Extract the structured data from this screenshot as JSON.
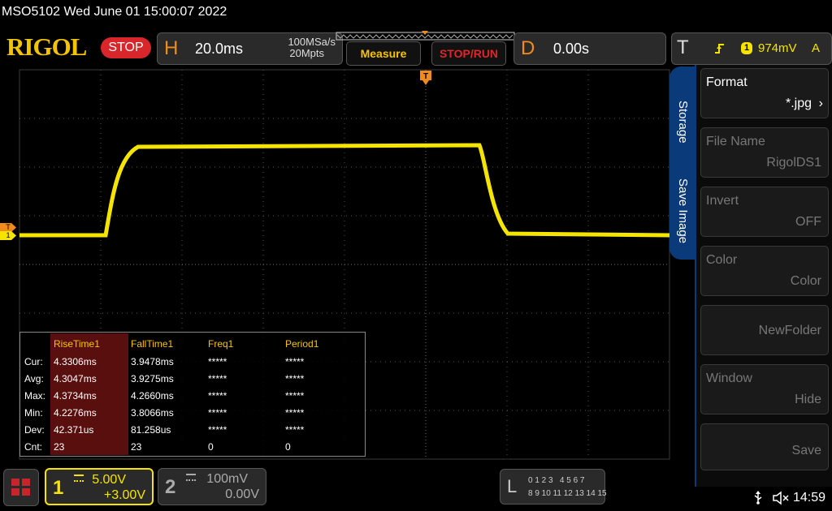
{
  "header": {
    "model_datetime": "MSO5102   Wed June 01 15:00:07 2022",
    "logo": "RIGOL",
    "run_state": "STOP",
    "h_letter": "H",
    "timebase": "20.0ms",
    "sample_rate": "100MSa/s",
    "memory_depth": "20Mpts",
    "measure_label": "Measure",
    "stoprun_label": "STOP/RUN",
    "d_letter": "D",
    "delay": "0.00s",
    "t_letter": "T",
    "trigger_channel": "1",
    "trigger_level": "974mV",
    "trigger_mode": "A"
  },
  "trigger_marker": "T",
  "channel_marker": "1",
  "measurements": {
    "columns": [
      "RiseTime1",
      "FallTime1",
      "Freq1",
      "Period1"
    ],
    "rows": [
      {
        "label": "Cur:",
        "values": [
          "4.3306ms",
          "3.9478ms",
          "*****",
          "*****"
        ]
      },
      {
        "label": "Avg:",
        "values": [
          "4.3047ms",
          "3.9275ms",
          "*****",
          "*****"
        ]
      },
      {
        "label": "Max:",
        "values": [
          "4.3734ms",
          "4.2660ms",
          "*****",
          "*****"
        ]
      },
      {
        "label": "Min:",
        "values": [
          "4.2276ms",
          "3.8066ms",
          "*****",
          "*****"
        ]
      },
      {
        "label": "Dev:",
        "values": [
          "42.371us",
          "81.258us",
          "*****",
          "*****"
        ]
      },
      {
        "label": "Cnt:",
        "values": [
          "23",
          "23",
          "0",
          "0"
        ]
      }
    ]
  },
  "side_tabs": {
    "storage": "Storage",
    "save_image": "Save Image"
  },
  "menu": [
    {
      "label": "Format",
      "value": "*.jpg",
      "enabled": true
    },
    {
      "label": "File Name",
      "value": "RigolDS1",
      "enabled": false
    },
    {
      "label": "Invert",
      "value": "OFF",
      "enabled": false
    },
    {
      "label": "Color",
      "value": "Color",
      "enabled": false
    },
    {
      "label": "",
      "value": "NewFolder",
      "enabled": false
    },
    {
      "label": "Window",
      "value": "Hide",
      "enabled": false
    },
    {
      "label": "",
      "value": "Save",
      "enabled": false
    }
  ],
  "footer": {
    "ch1_number": "1",
    "ch1_scale": "5.00V",
    "ch1_offset": "+3.00V",
    "ch2_number": "2",
    "ch2_scale": "100mV",
    "ch2_offset": "0.00V",
    "la_letter": "L",
    "la_row1": "0 1 2 3   4 5 6 7",
    "la_row2": "8 9 10 11 12 13 14 15",
    "time": "14:59"
  },
  "colors": {
    "ch1": "#f5e400",
    "accent_orange": "#f08b1c",
    "stop_red": "#d8262a",
    "menu_blue": "#0a3a7a"
  }
}
